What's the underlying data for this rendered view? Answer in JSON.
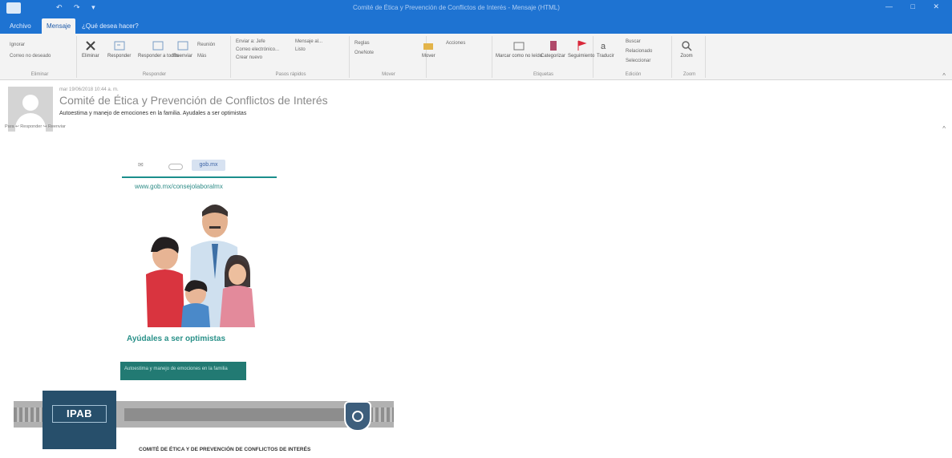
{
  "window": {
    "title": "Comité de Ética y Prevención de Conflictos de Interés - Mensaje (HTML)",
    "controls": "— □ ✕"
  },
  "ribbon": {
    "tabs": [
      {
        "label": "Archivo"
      },
      {
        "label": "Mensaje"
      },
      {
        "label": "¿Qué desea hacer?"
      }
    ],
    "groups": {
      "quick": {
        "items": [
          "Ignorar",
          "Correo no deseado"
        ],
        "label": "Eliminar"
      },
      "respond": {
        "delete": "Eliminar",
        "reply": "Responder",
        "reply_all": "Responder a todos",
        "forward": "Reenviar",
        "more": "Más",
        "meeting": "Reunión",
        "label": "Responder"
      },
      "quicksteps": {
        "items": [
          "Enviar a: Jefe",
          "Correo electrónico...",
          "Crear nuevo"
        ],
        "items2": [
          "Mensaje al...",
          "Listo"
        ],
        "label": "Pasos rápidos"
      },
      "move": {
        "move": "Mover",
        "rules": "Reglas",
        "onenote": "OneNote",
        "actions": "Acciones",
        "label": "Mover"
      },
      "tags": {
        "unread": "Marcar como no leído",
        "categorize": "Categorizar",
        "followup": "Seguimiento",
        "label": "Etiquetas"
      },
      "edit": {
        "translate": "Traducir",
        "find": "Buscar",
        "related": "Relacionado",
        "select": "Seleccionar",
        "label": "Edición"
      },
      "zoom": {
        "zoom": "Zoom",
        "label": "Zoom"
      }
    }
  },
  "message": {
    "meta": "mar 19/06/2018 10:44 a. m.",
    "sender": "Comité de Ética y Prevención de Conflictos de Interés",
    "subject": "Autoestima y manejo de emociones en la familia. Ayudales a ser optimistas",
    "actions": "Para   ↩ Responder   ↪ Reenviar"
  },
  "body": {
    "strip_pill": "gob.mx",
    "strip_pill2": "",
    "url": "www.gob.mx/consejolaboralmx",
    "slogan": "Ayúdales a ser optimistas",
    "cta": "Autoestima y manejo de emociones en la familia",
    "ipab_logo": "IPAB",
    "footer_text": "",
    "committee": "COMITÉ DE ÉTICA Y DE PREVENCIÓN DE CONFLICTOS DE INTERÉS"
  },
  "colors": {
    "titlebar": "#1e73d2",
    "ribbon": "#f3f3f3",
    "teal": "#1b8e8c",
    "ipab": "#274f6b"
  }
}
